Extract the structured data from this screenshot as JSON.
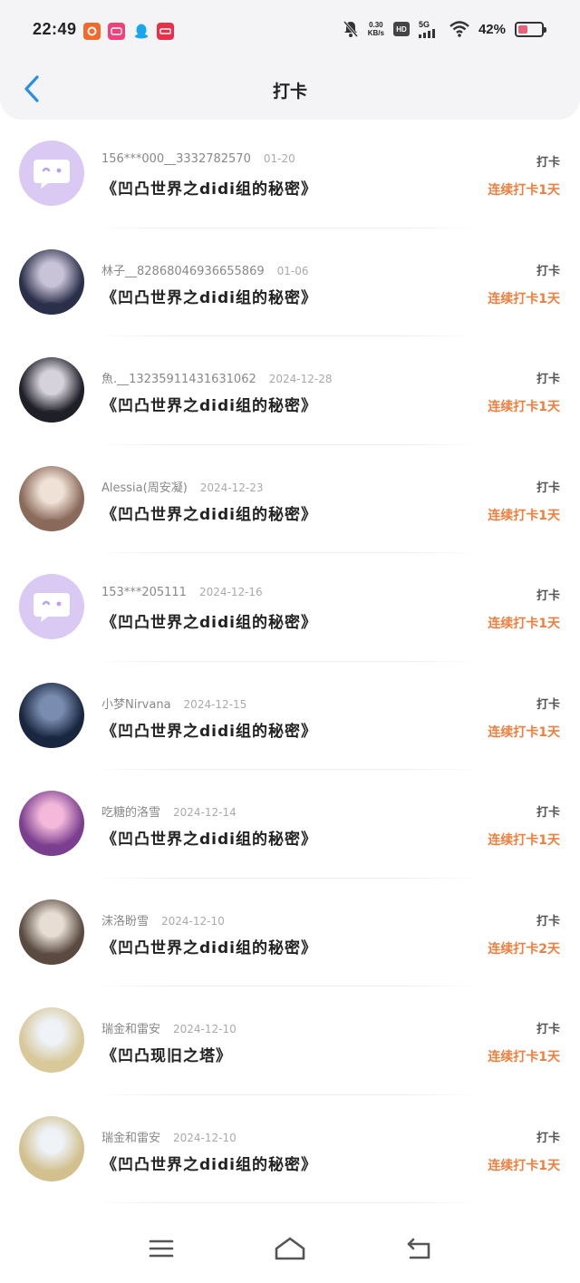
{
  "status_bar": {
    "time": "22:49",
    "net_speed_value": "0.30",
    "net_speed_unit": "KB/s",
    "hd": "HD",
    "signal": "5G",
    "battery_percent": "42%",
    "battery_level": 0.42,
    "app_icons": [
      "app-icon-orange",
      "app-icon-pink",
      "qq-icon",
      "app-icon-red"
    ]
  },
  "header": {
    "title": "打卡"
  },
  "items": [
    {
      "user": "156***000__3332782570",
      "date": "01-20",
      "book": "《凹凸世界之didi组的秘密》",
      "action": "打卡",
      "streak": "连续打卡1天",
      "avatar": "default"
    },
    {
      "user": "林子__82868046936655869",
      "date": "01-06",
      "book": "《凹凸世界之didi组的秘密》",
      "action": "打卡",
      "streak": "连续打卡1天",
      "avatar": "photo"
    },
    {
      "user": "魚.__13235911431631062",
      "date": "2024-12-28",
      "book": "《凹凸世界之didi组的秘密》",
      "action": "打卡",
      "streak": "连续打卡1天",
      "avatar": "photo"
    },
    {
      "user": "Alessia(周安凝)",
      "date": "2024-12-23",
      "book": "《凹凸世界之didi组的秘密》",
      "action": "打卡",
      "streak": "连续打卡1天",
      "avatar": "photo"
    },
    {
      "user": "153***205111",
      "date": "2024-12-16",
      "book": "《凹凸世界之didi组的秘密》",
      "action": "打卡",
      "streak": "连续打卡1天",
      "avatar": "default"
    },
    {
      "user": "小梦Nirvana",
      "date": "2024-12-15",
      "book": "《凹凸世界之didi组的秘密》",
      "action": "打卡",
      "streak": "连续打卡1天",
      "avatar": "photo"
    },
    {
      "user": "吃糖的洛雪",
      "date": "2024-12-14",
      "book": "《凹凸世界之didi组的秘密》",
      "action": "打卡",
      "streak": "连续打卡1天",
      "avatar": "photo"
    },
    {
      "user": "沫洛盼雪",
      "date": "2024-12-10",
      "book": "《凹凸世界之didi组的秘密》",
      "action": "打卡",
      "streak": "连续打卡2天",
      "avatar": "photo"
    },
    {
      "user": "瑞金和雷安",
      "date": "2024-12-10",
      "book": "《凹凸现旧之塔》",
      "action": "打卡",
      "streak": "连续打卡1天",
      "avatar": "photo"
    },
    {
      "user": "瑞金和雷安",
      "date": "2024-12-10",
      "book": "《凹凸世界之didi组的秘密》",
      "action": "打卡",
      "streak": "连续打卡1天",
      "avatar": "photo"
    }
  ],
  "nav": {
    "icons": [
      "menu-icon",
      "home-icon",
      "back-icon"
    ]
  },
  "colors": {
    "accent_blue": "#2a8fe6",
    "streak_orange": "#ef7f3f",
    "default_avatar": "#d9c9f3"
  }
}
